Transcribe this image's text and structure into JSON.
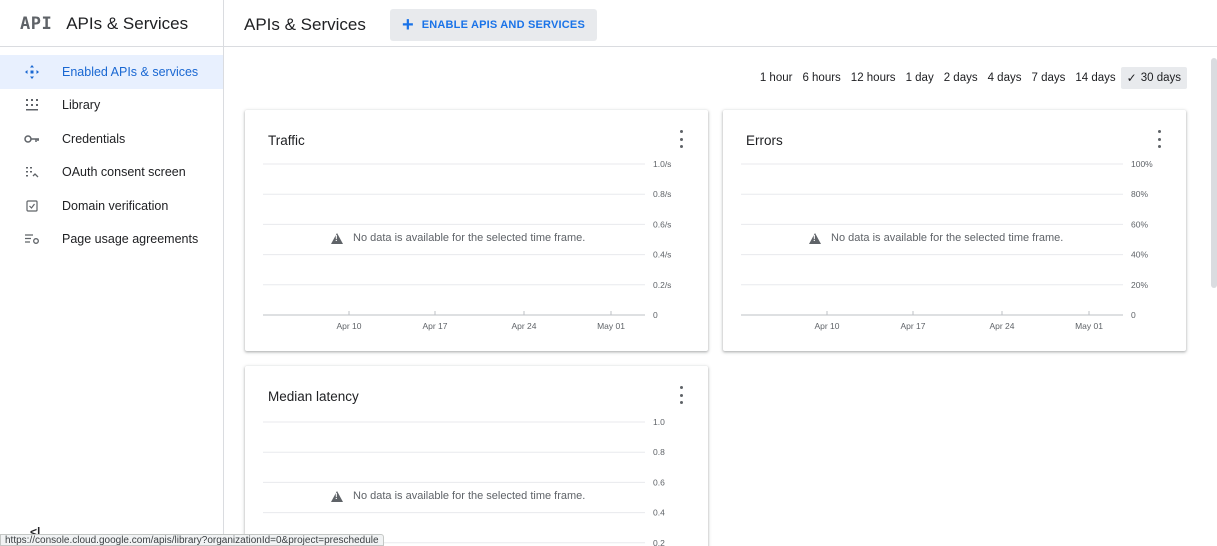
{
  "header": {
    "logo": "API",
    "brand_title": "APIs & Services",
    "page_title": "APIs & Services",
    "enable_button": "ENABLE APIS AND SERVICES"
  },
  "sidebar": {
    "items": [
      {
        "label": "Enabled APIs & services",
        "icon": "diamond-icon",
        "active": true
      },
      {
        "label": "Library",
        "icon": "library-icon",
        "active": false
      },
      {
        "label": "Credentials",
        "icon": "key-icon",
        "active": false
      },
      {
        "label": "OAuth consent screen",
        "icon": "consent-icon",
        "active": false
      },
      {
        "label": "Domain verification",
        "icon": "checkbox-icon",
        "active": false
      },
      {
        "label": "Page usage agreements",
        "icon": "settings-list-icon",
        "active": false
      }
    ],
    "collapse": "<|"
  },
  "time_range": {
    "options": [
      "1 hour",
      "6 hours",
      "12 hours",
      "1 day",
      "2 days",
      "4 days",
      "7 days",
      "14 days",
      "30 days"
    ],
    "selected": "30 days"
  },
  "cards": {
    "traffic": {
      "title": "Traffic",
      "nodata": "No data is available for the selected time frame.",
      "y_ticks": [
        "1.0/s",
        "0.8/s",
        "0.6/s",
        "0.4/s",
        "0.2/s",
        "0"
      ],
      "x_ticks": [
        "Apr 10",
        "Apr 17",
        "Apr 24",
        "May 01"
      ]
    },
    "errors": {
      "title": "Errors",
      "nodata": "No data is available for the selected time frame.",
      "y_ticks": [
        "100%",
        "80%",
        "60%",
        "40%",
        "20%",
        "0"
      ],
      "x_ticks": [
        "Apr 10",
        "Apr 17",
        "Apr 24",
        "May 01"
      ]
    },
    "latency": {
      "title": "Median latency",
      "nodata": "No data is available for the selected time frame.",
      "y_ticks": [
        "1.0",
        "0.8",
        "0.6",
        "0.4",
        "0.2"
      ]
    }
  },
  "status_url": "https://console.cloud.google.com/apis/library?organizationId=0&project=preschedule"
}
